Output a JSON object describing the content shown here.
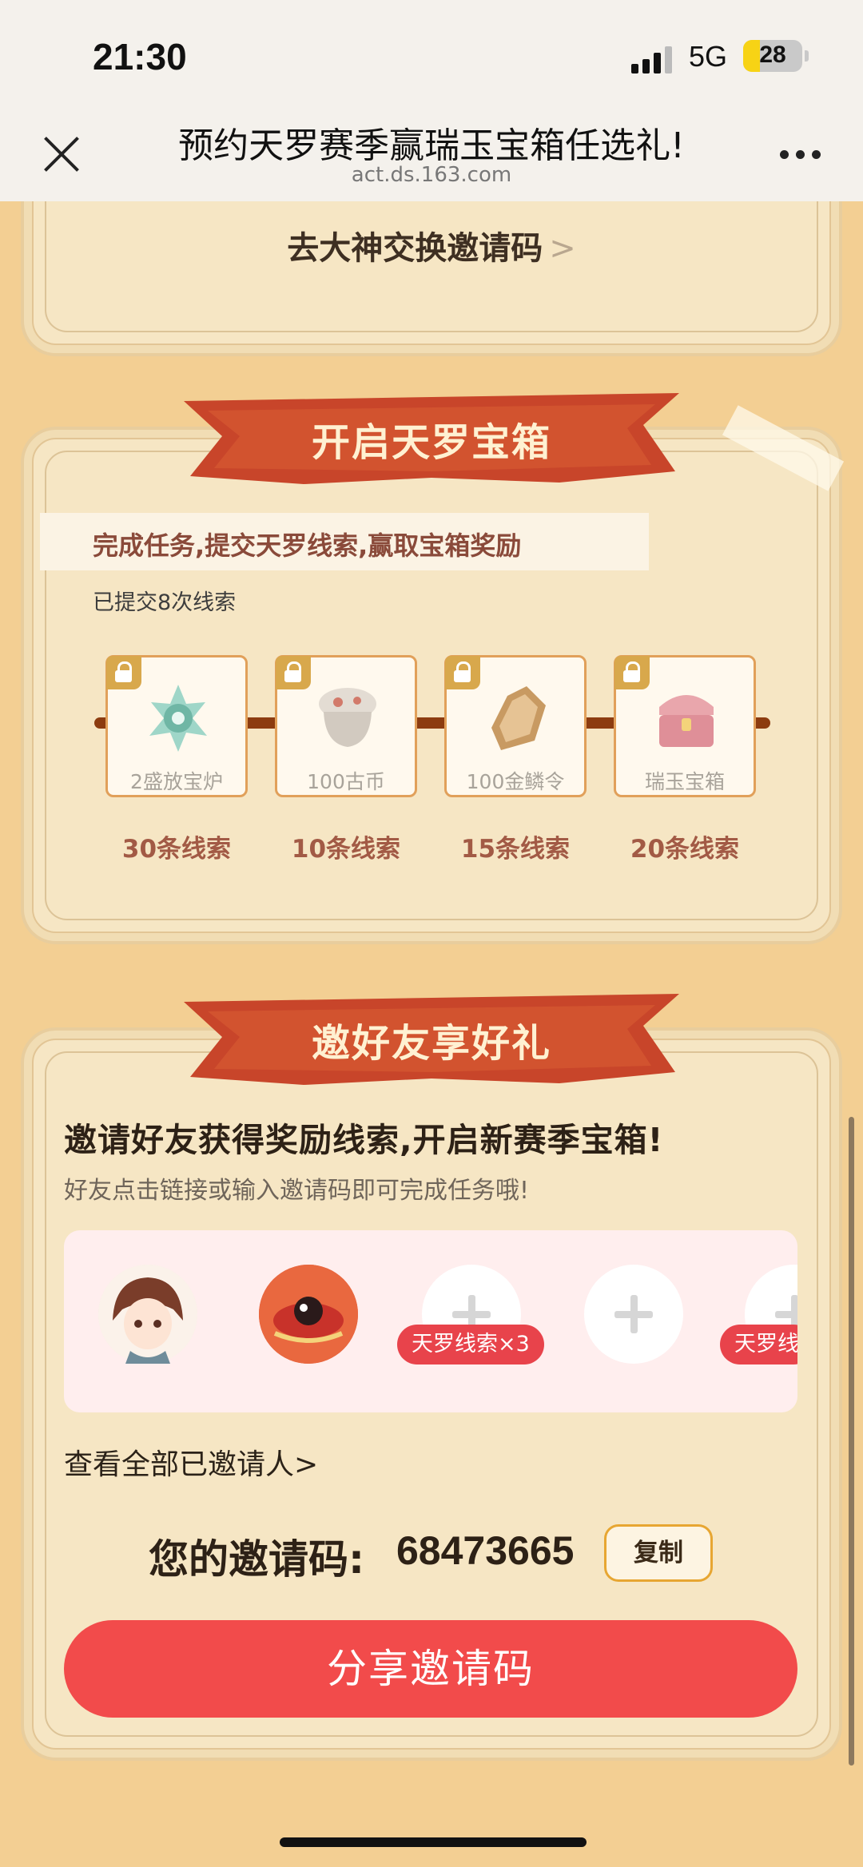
{
  "status": {
    "time": "21:30",
    "network": "5G",
    "battery": "28",
    "battery_level": 0.28
  },
  "nav": {
    "title": "预约天罗赛季赢瑞玉宝箱任选礼!",
    "url": "act.ds.163.com"
  },
  "exchange": {
    "label": "去大神交换邀请码",
    "chevron": ">"
  },
  "treasure": {
    "banner": "开启天罗宝箱",
    "task": "完成任务,提交天罗线索,赢取宝箱奖励",
    "submitted": "已提交8次线索",
    "rewards": [
      {
        "name": "2盛放宝炉",
        "clues": "30条线索",
        "icon": "lantern-icon"
      },
      {
        "name": "100古币",
        "clues": "10条线索",
        "icon": "pot-icon"
      },
      {
        "name": "100金鳞令",
        "clues": "15条线索",
        "icon": "shield-icon"
      },
      {
        "name": "瑞玉宝箱",
        "clues": "20条线索",
        "icon": "chest-icon"
      }
    ]
  },
  "invite": {
    "banner": "邀好友享好礼",
    "title": "邀请好友获得奖励线索,开启新赛季宝箱!",
    "subtitle": "好友点击链接或输入邀请码即可完成任务哦!",
    "slot_reward": "天罗线索×3",
    "slot_reward_cut": "天罗线",
    "see_all": "查看全部已邀请人>",
    "code_label": "您的邀请码:",
    "code": "68473665",
    "copy": "复制",
    "share": "分享邀请码"
  }
}
